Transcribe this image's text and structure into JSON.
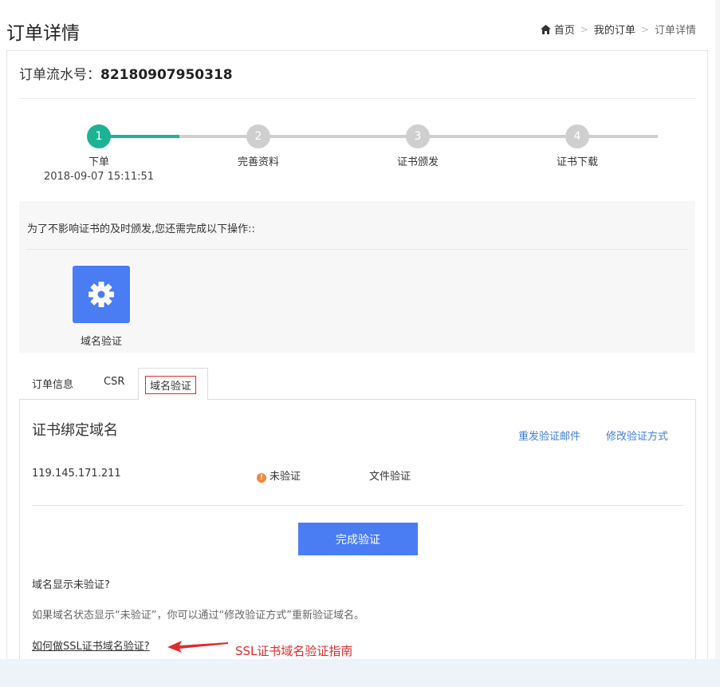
{
  "header": {
    "title": "订单详情",
    "breadcrumb": {
      "home": "首页",
      "sep": ">",
      "orders": "我的订单",
      "current": "订单详情"
    }
  },
  "order": {
    "label": "订单流水号：",
    "number": "82180907950318"
  },
  "steps": [
    {
      "num": "1",
      "label": "下单",
      "time": "2018-09-07 15:11:51"
    },
    {
      "num": "2",
      "label": "完善资料"
    },
    {
      "num": "3",
      "label": "证书颁发"
    },
    {
      "num": "4",
      "label": "证书下载"
    }
  ],
  "progress": {
    "current_step": 1,
    "total_steps": 4
  },
  "notice": {
    "text": "为了不影响证书的及时颁发,您还需完成以下操作::",
    "action_label": "域名验证"
  },
  "tabs": {
    "info": "订单信息",
    "csr": "CSR",
    "domain": "域名验证"
  },
  "domain_section": {
    "title": "证书绑定域名",
    "resend": "重发验证邮件",
    "modify": "修改验证方式",
    "domain": "119.145.171.211",
    "status": "未验证",
    "method": "文件验证",
    "complete_button": "完成验证",
    "faq_title": "域名显示未验证?",
    "faq_desc": "如果域名状态显示“未验证”，你可以通过“修改验证方式”重新验证域名。",
    "guide_link": "如何做SSL证书域名验证?",
    "annotation": "SSL证书域名验证指南"
  },
  "colors": {
    "accent": "#4a7cf3",
    "step_done": "#1bb394",
    "link": "#3d7dd8",
    "annotation_red": "#e02b2b",
    "warning": "#f0883a"
  }
}
